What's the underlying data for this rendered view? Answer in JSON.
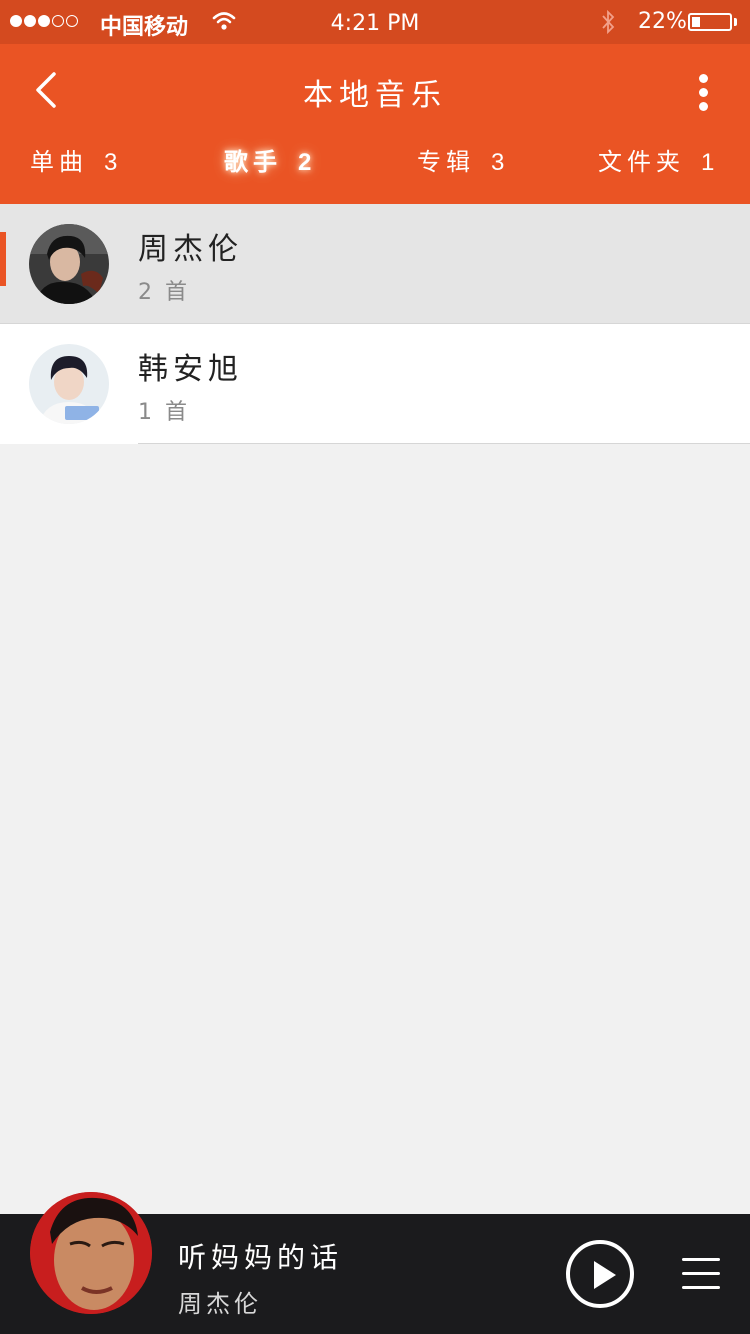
{
  "status_bar": {
    "signal_dots_filled": 3,
    "signal_dots_total": 5,
    "carrier": "中国移动",
    "time": "4:21 PM",
    "battery_percent": "22%",
    "battery_level": 0.22
  },
  "header": {
    "title": "本地音乐",
    "background_color": "#ea5424",
    "tabs": [
      {
        "label": "单曲",
        "count": "3",
        "active": false
      },
      {
        "label": "歌手",
        "count": "2",
        "active": true
      },
      {
        "label": "专辑",
        "count": "3",
        "active": false
      },
      {
        "label": "文件夹",
        "count": "1",
        "active": false
      }
    ]
  },
  "artists": [
    {
      "name": "周杰伦",
      "count_text": "2 首",
      "selected": true
    },
    {
      "name": "韩安旭",
      "count_text": "1 首",
      "selected": false
    }
  ],
  "player": {
    "song_title": "听妈妈的话",
    "artist": "周杰伦"
  },
  "icons": {
    "back": "chevron-left-icon",
    "more": "more-vertical-icon",
    "play": "play-icon",
    "playlist": "menu-icon",
    "wifi": "wifi-icon",
    "bluetooth": "bluetooth-icon",
    "battery": "battery-icon"
  }
}
